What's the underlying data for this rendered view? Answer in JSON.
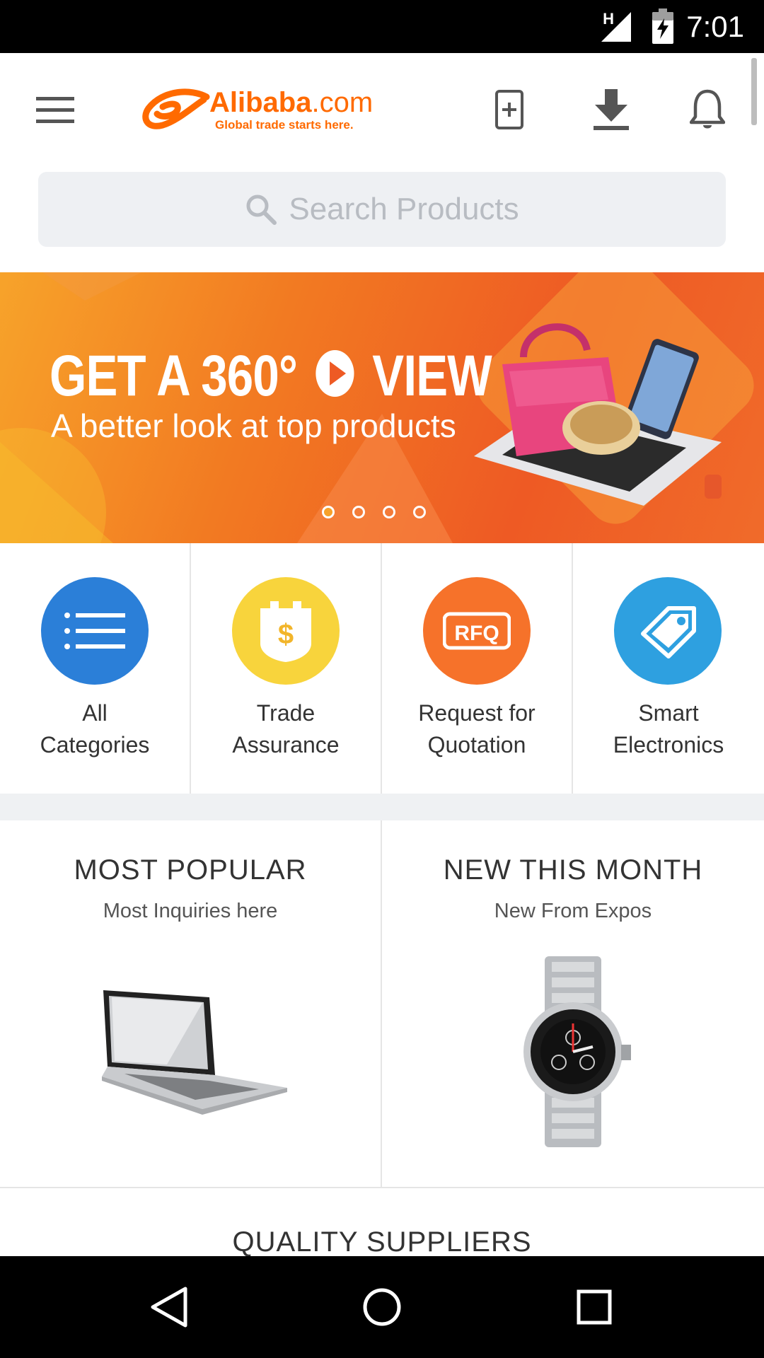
{
  "status_bar": {
    "time": "7:01",
    "network": "H"
  },
  "header": {
    "logo_brand": "Alibaba",
    "logo_tld": ".com",
    "logo_tagline": "Global trade starts here.",
    "icons": [
      "menu-icon",
      "phone-add-icon",
      "download-icon",
      "notification-bell-icon"
    ]
  },
  "search": {
    "placeholder": "Search Products"
  },
  "banner": {
    "headline_part1": "GET A 360°",
    "headline_part2": "VIEW",
    "subline": "A better look at top products",
    "slides_total": 4,
    "active_slide": 1
  },
  "quick_categories": [
    {
      "line1": "All",
      "line2": "Categories",
      "icon": "list-icon",
      "color": "#2b7fd8"
    },
    {
      "line1": "Trade",
      "line2": "Assurance",
      "icon": "trade-assurance-shield-icon",
      "color": "#f8d43c"
    },
    {
      "line1": "Request for",
      "line2": "Quotation",
      "icon": "rfq-icon",
      "color": "#f6722a"
    },
    {
      "line1": "Smart",
      "line2": "Electronics",
      "icon": "price-tag-icon",
      "color": "#2ea0e0"
    }
  ],
  "rfq_icon_text": "RFQ",
  "featured": [
    {
      "title": "MOST POPULAR",
      "subtitle": "Most Inquiries here",
      "image": "laptop"
    },
    {
      "title": "NEW THIS MONTH",
      "subtitle": "New From Expos",
      "image": "wristwatch"
    }
  ],
  "next_section": {
    "title": "QUALITY SUPPLIERS"
  },
  "colors": {
    "brand_orange": "#ff6a00",
    "search_bg": "#eef0f3"
  }
}
